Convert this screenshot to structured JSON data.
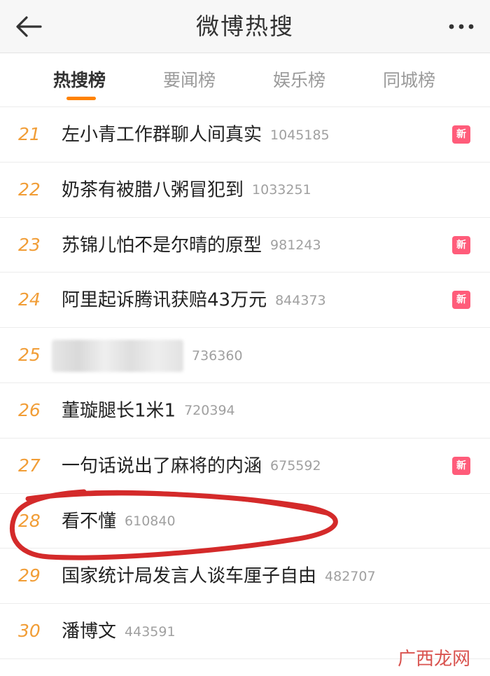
{
  "header": {
    "title": "微博热搜",
    "back_icon": "arrow-left-icon",
    "more_icon": "more-dots-icon"
  },
  "tabs": [
    {
      "label": "热搜榜",
      "active": true
    },
    {
      "label": "要闻榜",
      "active": false
    },
    {
      "label": "娱乐榜",
      "active": false
    },
    {
      "label": "同城榜",
      "active": false
    }
  ],
  "list": [
    {
      "rank": "21",
      "topic": "左小青工作群聊人间真实",
      "heat": "1045185",
      "badge": "新"
    },
    {
      "rank": "22",
      "topic": "奶茶有被腊八粥冒犯到",
      "heat": "1033251",
      "badge": ""
    },
    {
      "rank": "23",
      "topic": "苏锦儿怕不是尔晴的原型",
      "heat": "981243",
      "badge": "新"
    },
    {
      "rank": "24",
      "topic": "阿里起诉腾讯获赔43万元",
      "heat": "844373",
      "badge": "新"
    },
    {
      "rank": "25",
      "topic": "",
      "heat": "736360",
      "badge": ""
    },
    {
      "rank": "26",
      "topic": "董璇腿长1米1",
      "heat": "720394",
      "badge": ""
    },
    {
      "rank": "27",
      "topic": "一句话说出了麻将的内涵",
      "heat": "675592",
      "badge": "新"
    },
    {
      "rank": "28",
      "topic": "看不懂",
      "heat": "610840",
      "badge": ""
    },
    {
      "rank": "29",
      "topic": "国家统计局发言人谈车厘子自由",
      "heat": "482707",
      "badge": ""
    },
    {
      "rank": "30",
      "topic": "潘博文",
      "heat": "443591",
      "badge": ""
    }
  ],
  "watermark": "广西龙网",
  "colors": {
    "rank": "#f19d36",
    "badge": "#ff5c7a",
    "tab_active_underline": "#ff8200",
    "annotation": "#d42a2a"
  }
}
